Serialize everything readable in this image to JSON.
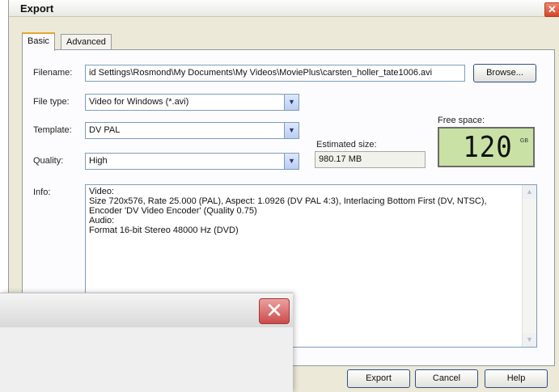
{
  "window": {
    "title": "Export",
    "close_glyph": "✕"
  },
  "tabs": [
    {
      "label": "Basic",
      "active": true
    },
    {
      "label": "Advanced",
      "active": false
    }
  ],
  "form": {
    "filename_label": "Filename:",
    "filename_value": "id Settings\\Rosmond\\My Documents\\My Videos\\MoviePlus\\carsten_holler_tate1006.avi",
    "browse_label": "Browse...",
    "filetype_label": "File type:",
    "filetype_value": "Video for Windows (*.avi)",
    "template_label": "Template:",
    "template_value": "DV PAL",
    "quality_label": "Quality:",
    "quality_value": "High",
    "estimated_size_label": "Estimated size:",
    "estimated_size_value": "980.17 MB",
    "free_space_label": "Free space:",
    "free_space_value": "120",
    "free_space_unit": "GB",
    "info_label": "Info:",
    "info_lines": [
      "Video:",
      "Size 720x576, Rate 25.000 (PAL), Aspect: 1.0926 (DV PAL 4:3), Interlacing Bottom First (DV, NTSC),",
      "Encoder 'DV Video Encoder' (Quality 0.75)",
      "Audio:",
      "Format 16-bit Stereo 48000 Hz (DVD)"
    ]
  },
  "buttons": {
    "export": "Export",
    "cancel": "Cancel",
    "help": "Help"
  },
  "overlay_window": {
    "close_glyph": "✕"
  },
  "colors": {
    "lcd_background": "#c9e1a5",
    "tab_active_accent": "#e6a52e",
    "close_button": "#d4452a"
  }
}
